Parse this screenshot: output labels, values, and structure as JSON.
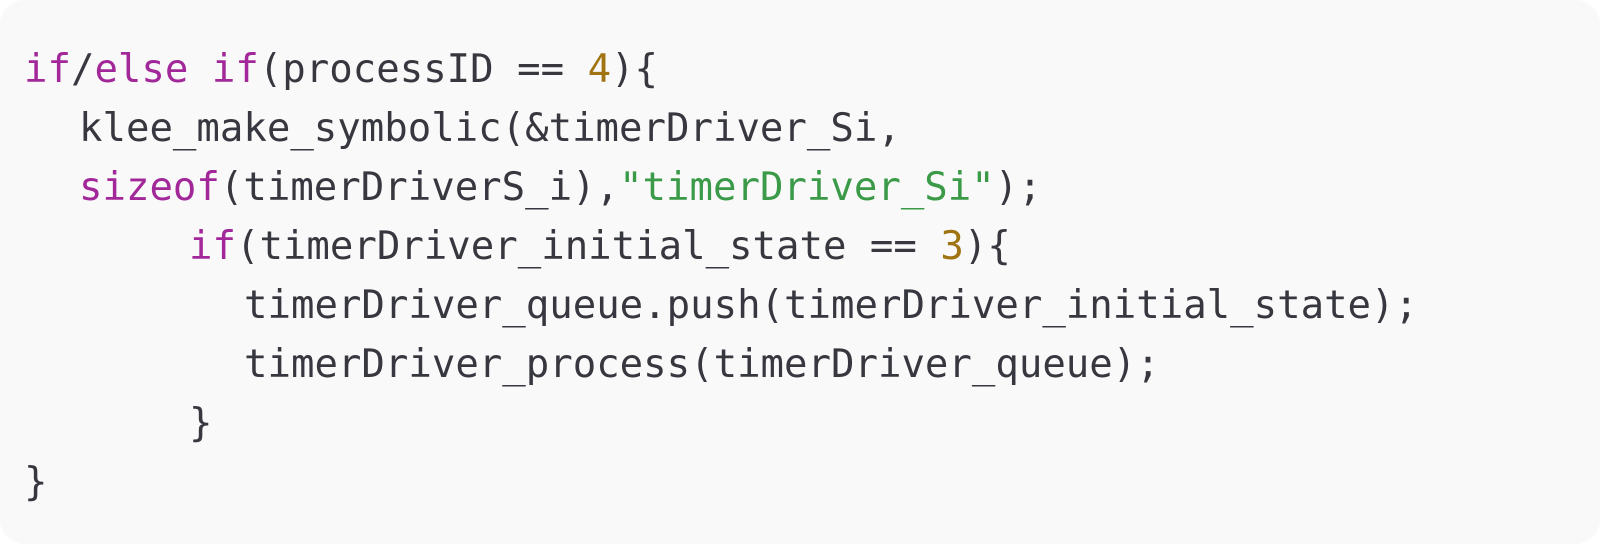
{
  "code": {
    "language": "c",
    "colors": {
      "background": "#f9f9f9",
      "text": "#37373f",
      "keyword": "#a2289a",
      "number": "#a07412",
      "string": "#3a9a48"
    },
    "lines": [
      {
        "indent": 0,
        "tokens": [
          {
            "t": "kw",
            "text": "if"
          },
          {
            "t": "plain",
            "text": "/"
          },
          {
            "t": "kw",
            "text": "else if"
          },
          {
            "t": "plain",
            "text": "(processID == "
          },
          {
            "t": "num",
            "text": "4"
          },
          {
            "t": "plain",
            "text": "){"
          }
        ]
      },
      {
        "indent": 1,
        "tokens": [
          {
            "t": "plain",
            "text": "klee_make_symbolic(&timerDriver_Si,"
          }
        ]
      },
      {
        "indent": 1,
        "tokens": [
          {
            "t": "kw",
            "text": "sizeof"
          },
          {
            "t": "plain",
            "text": "(timerDriverS_i),"
          },
          {
            "t": "str",
            "text": "\"timerDriver_Si\""
          },
          {
            "t": "plain",
            "text": ");"
          }
        ]
      },
      {
        "indent": 3,
        "tokens": [
          {
            "t": "kw",
            "text": "if"
          },
          {
            "t": "plain",
            "text": "(timerDriver_initial_state == "
          },
          {
            "t": "num",
            "text": "3"
          },
          {
            "t": "plain",
            "text": "){"
          }
        ]
      },
      {
        "indent": 4,
        "tokens": [
          {
            "t": "plain",
            "text": "timerDriver_queue.push(timerDriver_initial_state);"
          }
        ]
      },
      {
        "indent": 4,
        "tokens": [
          {
            "t": "plain",
            "text": "timerDriver_process(timerDriver_queue);"
          }
        ]
      },
      {
        "indent": 3,
        "tokens": [
          {
            "t": "plain",
            "text": "}"
          }
        ]
      },
      {
        "indent": 0,
        "tokens": [
          {
            "t": "plain",
            "text": "}"
          }
        ]
      }
    ]
  }
}
